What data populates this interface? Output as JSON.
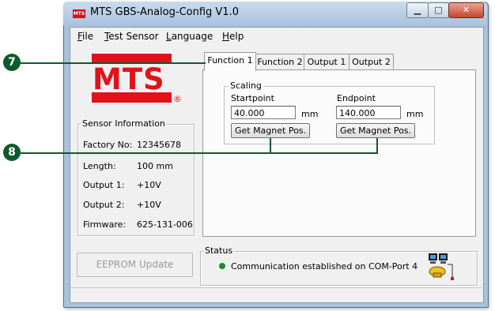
{
  "window": {
    "title": "MTS GBS-Analog-Config V1.0",
    "app_icon": "mts-app-icon",
    "controls": {
      "minimize": "minimize-icon",
      "maximize": "maximize-icon",
      "close": "close-icon"
    }
  },
  "menu": [
    {
      "key": "F",
      "rest": "ile"
    },
    {
      "key": "T",
      "rest": "est Sensor"
    },
    {
      "key": "L",
      "rest": "anguage"
    },
    {
      "key": "H",
      "rest": "elp"
    }
  ],
  "logo": {
    "text": "MTS",
    "reg": "®",
    "color": "#e2121b"
  },
  "sensor_info": {
    "title": "Sensor Information",
    "rows": [
      {
        "label": "Factory No:",
        "value": "12345678"
      },
      {
        "label": "Length:",
        "value": "100 mm"
      },
      {
        "label": "Output 1:",
        "value": "+10V"
      },
      {
        "label": "Output 2:",
        "value": "+10V"
      },
      {
        "label": "Firmware:",
        "value": "625-131-006"
      }
    ]
  },
  "tabs": [
    "Function 1",
    "Function 2",
    "Output 1",
    "Output 2"
  ],
  "active_tab": "Function 1",
  "scaling": {
    "title": "Scaling",
    "start_label": "Startpoint",
    "start_value": "40.000",
    "end_label": "Endpoint",
    "end_value": "140.000",
    "unit": "mm",
    "get_pos_label": "Get Magnet Pos."
  },
  "eeprom_button": "EEPROM Update",
  "status": {
    "title": "Status",
    "message": "Communication established on COM-Port 4",
    "indicator_color": "#1f8a2e",
    "network_icon": "network-computers-icon"
  },
  "callouts": [
    "7",
    "8"
  ]
}
